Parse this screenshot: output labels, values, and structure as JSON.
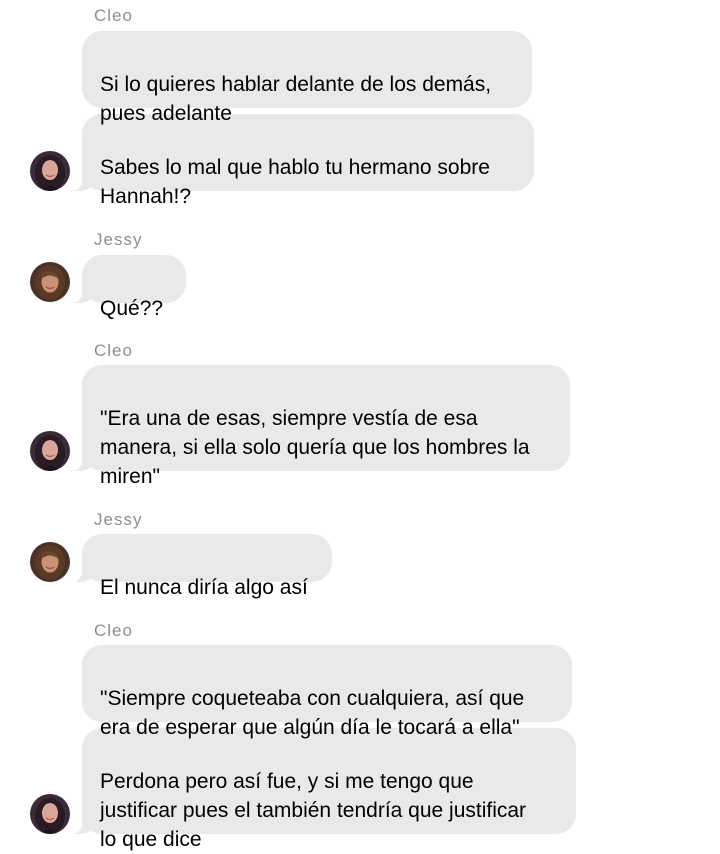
{
  "conversation": {
    "groups": [
      {
        "sender": "Cleo",
        "messages": [
          "Si lo quieres hablar delante de los demás,\npues adelante",
          "Sabes lo mal que hablo tu hermano sobre\nHannah!?"
        ]
      },
      {
        "sender": "Jessy",
        "messages": [
          "Qué??"
        ]
      },
      {
        "sender": "Cleo",
        "messages": [
          "\"Era una de esas, siempre vestía de esa\nmanera, si ella solo quería que los hombres la\nmiren\""
        ]
      },
      {
        "sender": "Jessy",
        "messages": [
          "El nunca diría algo así"
        ]
      },
      {
        "sender": "Cleo",
        "messages": [
          "\"Siempre coqueteaba con cualquiera, así que\nera de esperar que algún día le tocará a ella\"",
          "Perdona pero así fue, y si me tengo que\njustificar pues el también tendría que justificar\nlo que dice"
        ]
      }
    ]
  },
  "avatars": {
    "cleo": {
      "icon": "cleo-avatar",
      "hair_color": "#2a1b24",
      "skin_color": "#d9a79a",
      "background": "#3b2a38"
    },
    "jessy": {
      "icon": "jessy-avatar",
      "hair_color": "#5a3a26",
      "skin_color": "#c89274",
      "background": "#4a3326"
    }
  },
  "colors": {
    "bubble": "#e9e9eb",
    "sender_label": "#8e8e93",
    "text": "#000000",
    "background": "#ffffff"
  }
}
